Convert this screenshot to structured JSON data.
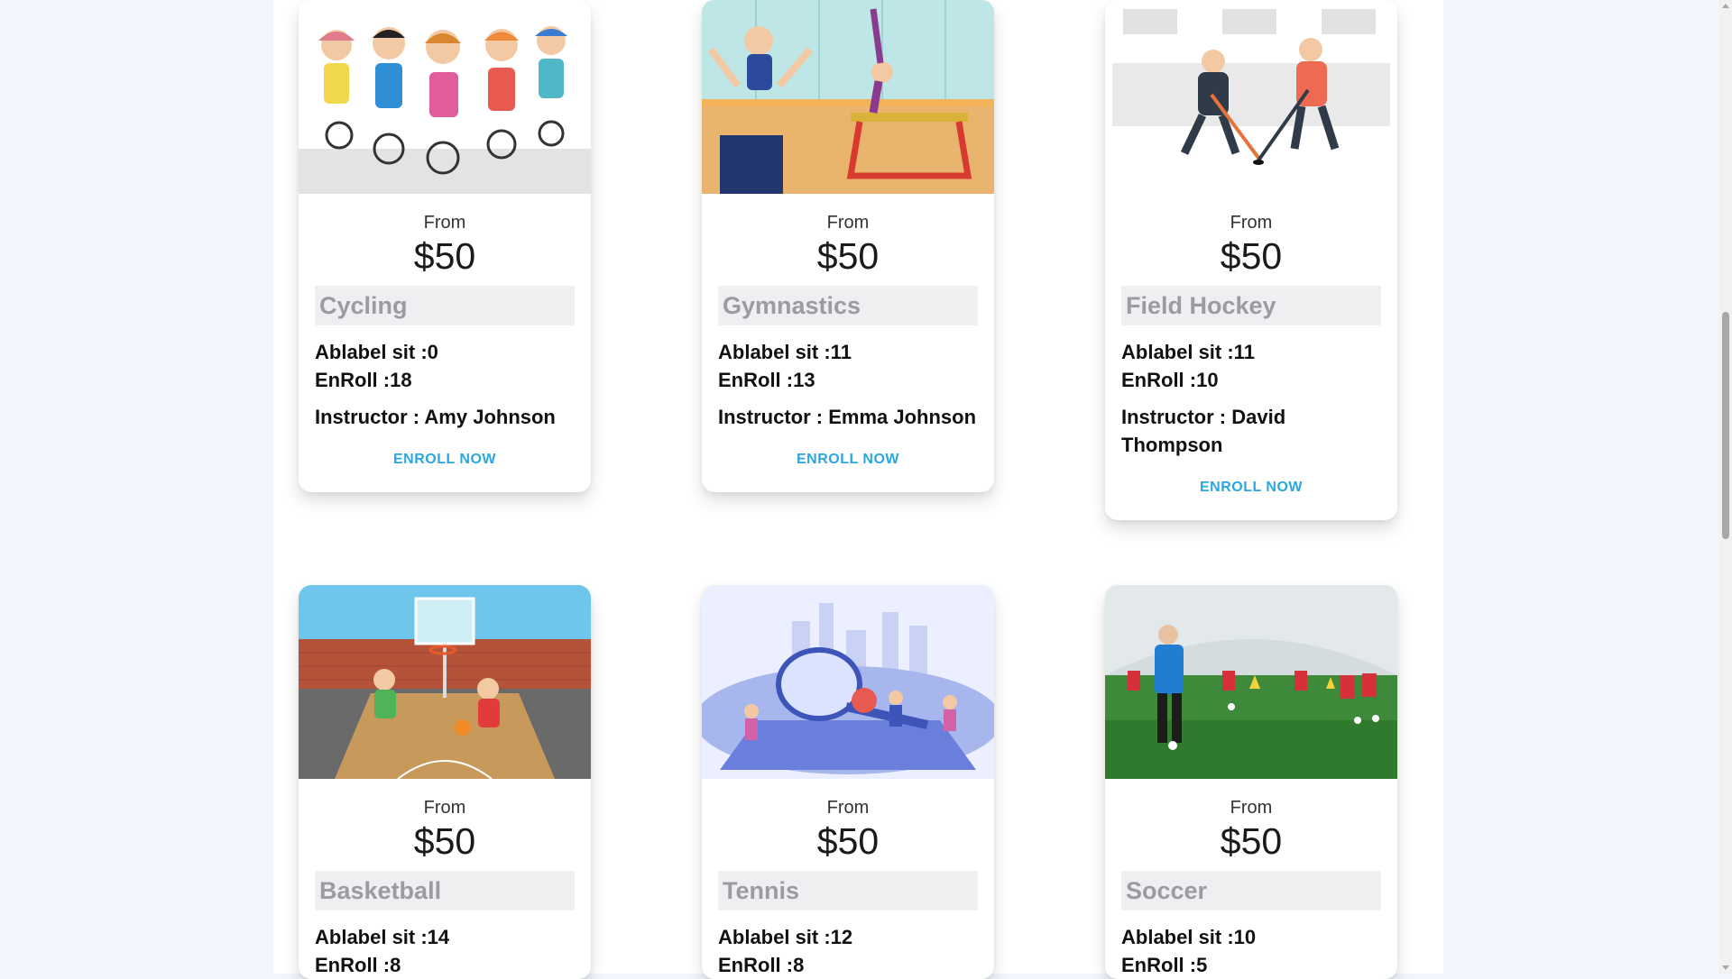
{
  "courses": [
    {
      "from_label": "From",
      "price": "$50",
      "name": "Cycling",
      "available": "Ablabel sit :0",
      "enroll": "EnRoll :18",
      "instructor": "Instructor : Amy Johnson",
      "button": "ENROLL NOW",
      "image_icon": "cycling-kids-illustration"
    },
    {
      "from_label": "From",
      "price": "$50",
      "name": "Gymnastics",
      "available": "Ablabel sit :11",
      "enroll": "EnRoll :13",
      "instructor": "Instructor : Emma Johnson",
      "button": "ENROLL NOW",
      "image_icon": "gymnastics-illustration"
    },
    {
      "from_label": "From",
      "price": "$50",
      "name": "Field Hockey",
      "available": "Ablabel sit :11",
      "enroll": "EnRoll :10",
      "instructor": "Instructor : David Thompson",
      "button": "ENROLL NOW",
      "image_icon": "hockey-players-illustration"
    },
    {
      "from_label": "From",
      "price": "$50",
      "name": "Basketball",
      "available": "Ablabel sit :14",
      "enroll": "EnRoll :8",
      "instructor": "",
      "button": "",
      "image_icon": "basketball-court-illustration"
    },
    {
      "from_label": "From",
      "price": "$50",
      "name": "Tennis",
      "available": "Ablabel sit :12",
      "enroll": "EnRoll :8",
      "instructor": "",
      "button": "",
      "image_icon": "tennis-illustration"
    },
    {
      "from_label": "From",
      "price": "$50",
      "name": "Soccer",
      "available": "Ablabel sit :10",
      "enroll": "EnRoll :5",
      "instructor": "",
      "button": "",
      "image_icon": "soccer-training-photo"
    }
  ],
  "colors": {
    "page_background": "#f1f5fd",
    "accent": "#2aa7df",
    "name_badge_bg": "#eeeff1",
    "name_text": "#9b9ba3"
  }
}
